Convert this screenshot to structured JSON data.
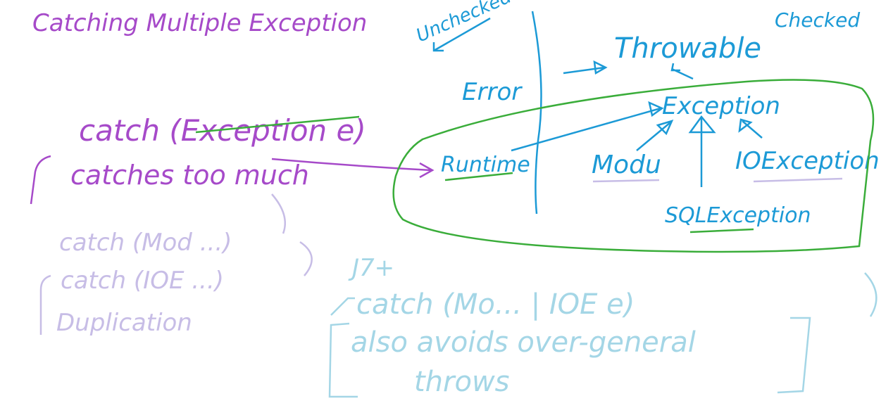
{
  "colors": {
    "purple": "#a64ac9",
    "blue": "#1c9ad6",
    "green": "#3aad3a",
    "lavender": "#c7bde6",
    "light_blue": "#a4d6e6",
    "background": "#ffffff"
  },
  "title": "Catching Multiple Exception",
  "left": {
    "catch_line": "catch (Exception e)",
    "catches_too_much": "catches too much",
    "catch_mod": "catch (Mod ...)",
    "catch_ioe": "catch (IOE ...)",
    "duplication": "Duplication"
  },
  "hierarchy": {
    "unchecked": "Unchecked",
    "checked": "Checked",
    "throwable": "Throwable",
    "error": "Error",
    "exception": "Exception",
    "runtime": "Runtime",
    "modu": "Modu",
    "ioexception": "IOException",
    "sqlexception": "SQLException"
  },
  "java7": {
    "version": "J7+",
    "catch_line": "catch (Mo... | IOE        e)",
    "also_avoids": "also avoids over-general",
    "throws": "throws"
  }
}
